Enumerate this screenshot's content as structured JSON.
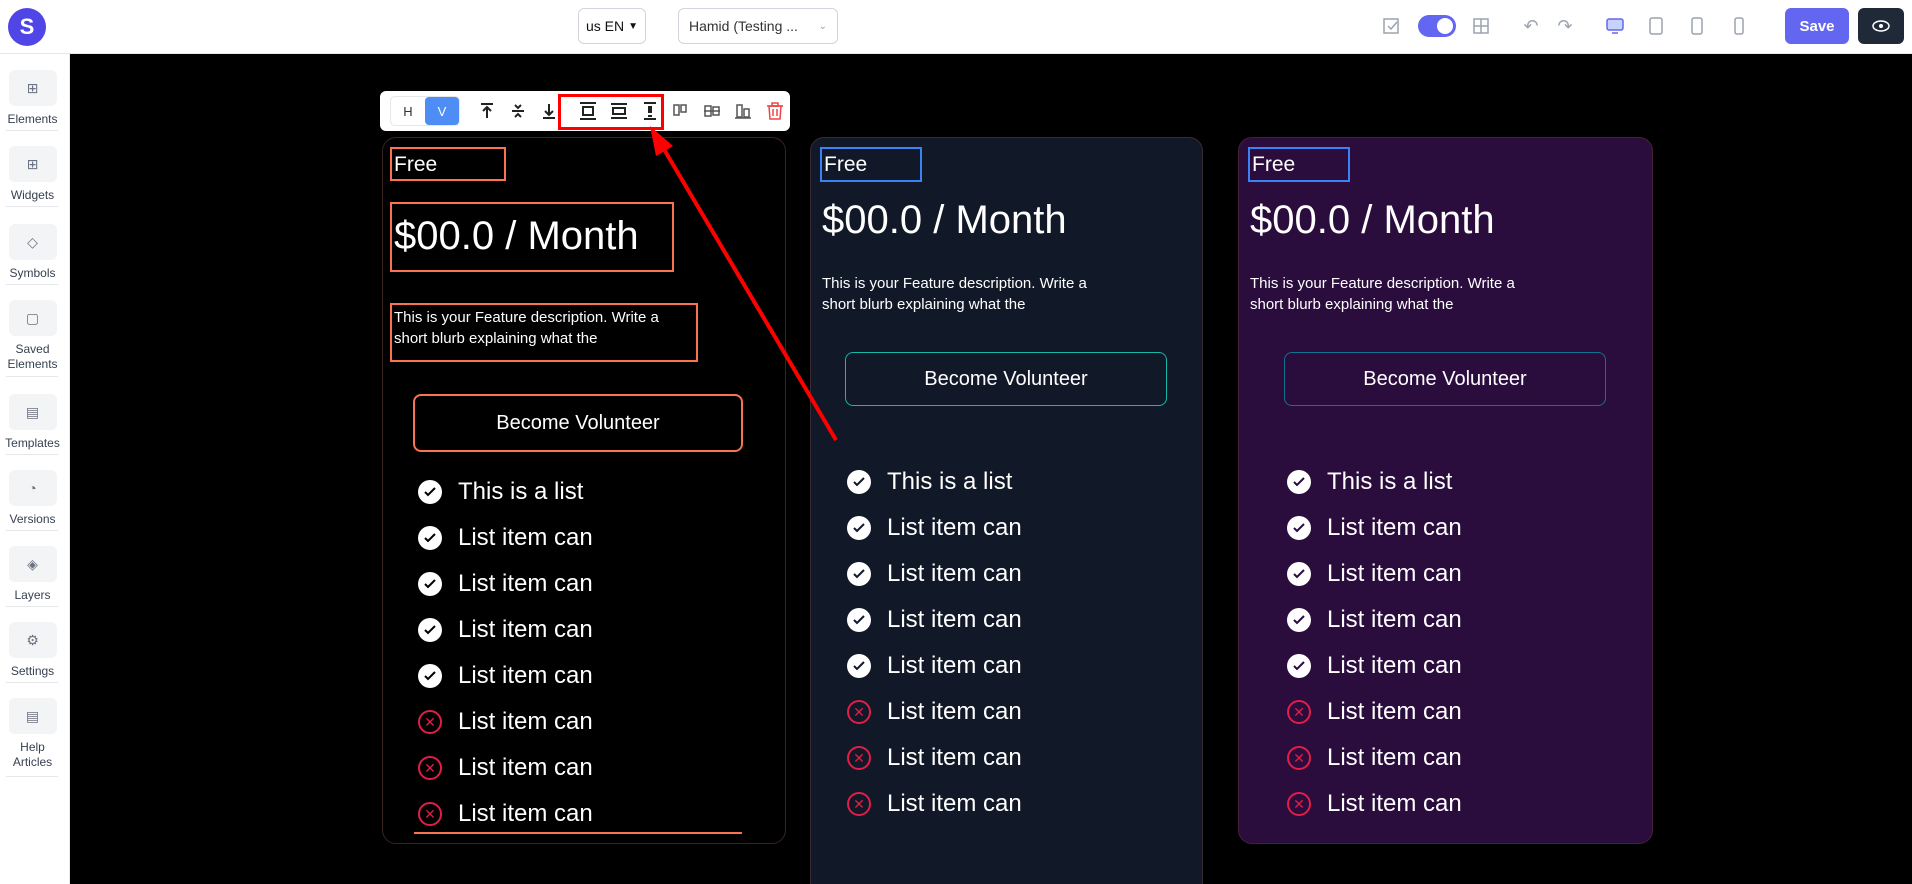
{
  "topbar": {
    "logo_text": "S",
    "lang_label": "us EN",
    "user_label": "Hamid (Testing ...",
    "save_label": "Save",
    "icons": [
      "checklist-icon",
      "toggle-switch",
      "grid-icon",
      "undo-icon",
      "redo-icon",
      "desktop-icon",
      "tablet-icon",
      "mobile-icon",
      "mobile-narrow-icon",
      "eye-icon"
    ]
  },
  "sidebar": {
    "items": [
      {
        "label": "Elements",
        "icon": "elements-icon"
      },
      {
        "label": "Widgets",
        "icon": "widgets-icon"
      },
      {
        "label": "Symbols",
        "icon": "symbols-icon"
      },
      {
        "label": "Saved Elements",
        "icon": "saved-icon"
      },
      {
        "label": "Templates",
        "icon": "templates-icon"
      },
      {
        "label": "Versions",
        "icon": "versions-icon"
      },
      {
        "label": "Layers",
        "icon": "layers-icon"
      },
      {
        "label": "Settings",
        "icon": "settings-icon"
      },
      {
        "label": "Help Articles",
        "icon": "help-icon"
      }
    ]
  },
  "toolbar": {
    "h_label": "H",
    "v_label": "V"
  },
  "cards": [
    {
      "tier": "Free",
      "price": "$00.0 / Month",
      "description": "This is your Feature description. Write a short blurb explaining what the",
      "button": "Become Volunteer",
      "items": [
        {
          "text": "This is a list",
          "included": true
        },
        {
          "text": "List item can",
          "included": true
        },
        {
          "text": "List item can",
          "included": true
        },
        {
          "text": "List item can",
          "included": true
        },
        {
          "text": "List item can",
          "included": true
        },
        {
          "text": "List item can",
          "included": false
        },
        {
          "text": "List item can",
          "included": false
        },
        {
          "text": "List item can",
          "included": false
        }
      ]
    },
    {
      "tier": "Free",
      "price": "$00.0 / Month",
      "description": "This is your Feature description. Write a short blurb explaining what the",
      "button": "Become Volunteer",
      "items": [
        {
          "text": "This is a list",
          "included": true
        },
        {
          "text": "List item can",
          "included": true
        },
        {
          "text": "List item can",
          "included": true
        },
        {
          "text": "List item can",
          "included": true
        },
        {
          "text": "List item can",
          "included": true
        },
        {
          "text": "List item can",
          "included": false
        },
        {
          "text": "List item can",
          "included": false
        },
        {
          "text": "List item can",
          "included": false
        }
      ]
    },
    {
      "tier": "Free",
      "price": "$00.0 / Month",
      "description": "This is your Feature description. Write a short blurb explaining what the",
      "button": "Become Volunteer",
      "items": [
        {
          "text": "This is a list",
          "included": true
        },
        {
          "text": "List item can",
          "included": true
        },
        {
          "text": "List item can",
          "included": true
        },
        {
          "text": "List item can",
          "included": true
        },
        {
          "text": "List item can",
          "included": true
        },
        {
          "text": "List item can",
          "included": false
        },
        {
          "text": "List item can",
          "included": false
        },
        {
          "text": "List item can",
          "included": false
        }
      ]
    }
  ],
  "colors": {
    "accent": "#6366f1",
    "selection_orange": "#f97350",
    "selection_blue": "#3b82f6",
    "annotation_red": "#ff0000",
    "excluded_red": "#e11d48"
  }
}
